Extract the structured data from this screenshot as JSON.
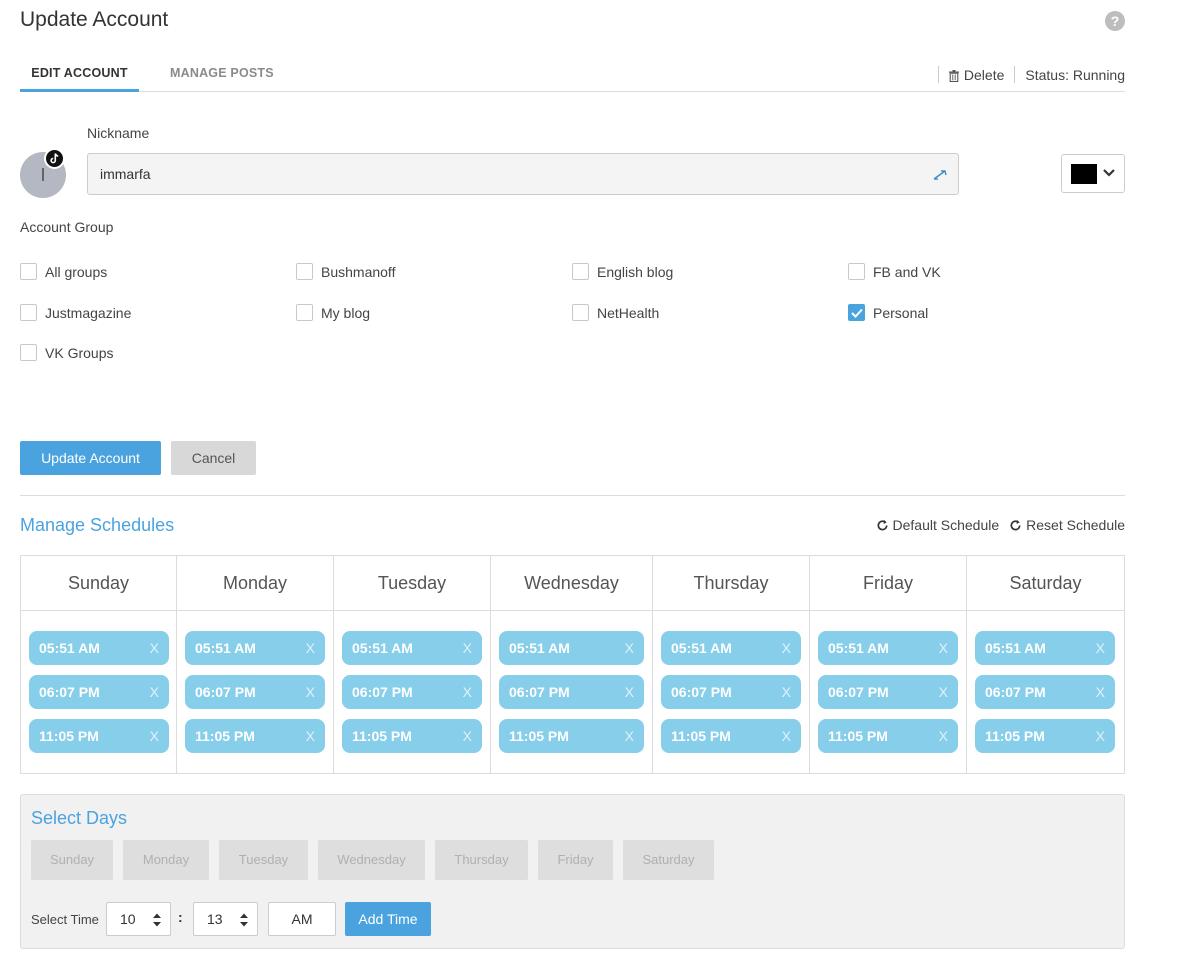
{
  "header": {
    "title": "Update Account"
  },
  "tabs": [
    {
      "label": "EDIT ACCOUNT",
      "active": true
    },
    {
      "label": "MANAGE POSTS",
      "active": false
    }
  ],
  "header_actions": {
    "delete_label": "Delete",
    "status": "Status: Running"
  },
  "account": {
    "avatar_initial": "I",
    "nickname_label": "Nickname",
    "nickname_value": "immarfa",
    "color": "#000000"
  },
  "account_group": {
    "label": "Account Group",
    "options": [
      {
        "label": "All groups",
        "checked": false
      },
      {
        "label": "Bushmanoff",
        "checked": false
      },
      {
        "label": "English blog",
        "checked": false
      },
      {
        "label": "FB and VK",
        "checked": false
      },
      {
        "label": "Justmagazine",
        "checked": false
      },
      {
        "label": "My blog",
        "checked": false
      },
      {
        "label": "NetHealth",
        "checked": false
      },
      {
        "label": "Personal",
        "checked": true
      },
      {
        "label": "VK Groups",
        "checked": false
      }
    ]
  },
  "form_buttons": {
    "update": "Update Account",
    "cancel": "Cancel"
  },
  "schedules": {
    "title": "Manage Schedules",
    "default_label": "Default Schedule",
    "reset_label": "Reset Schedule",
    "remove_label": "X",
    "days": [
      {
        "name": "Sunday",
        "times": [
          "05:51 AM",
          "06:07 PM",
          "11:05 PM"
        ]
      },
      {
        "name": "Monday",
        "times": [
          "05:51 AM",
          "06:07 PM",
          "11:05 PM"
        ]
      },
      {
        "name": "Tuesday",
        "times": [
          "05:51 AM",
          "06:07 PM",
          "11:05 PM"
        ]
      },
      {
        "name": "Wednesday",
        "times": [
          "05:51 AM",
          "06:07 PM",
          "11:05 PM"
        ]
      },
      {
        "name": "Thursday",
        "times": [
          "05:51 AM",
          "06:07 PM",
          "11:05 PM"
        ]
      },
      {
        "name": "Friday",
        "times": [
          "05:51 AM",
          "06:07 PM",
          "11:05 PM"
        ]
      },
      {
        "name": "Saturday",
        "times": [
          "05:51 AM",
          "06:07 PM",
          "11:05 PM"
        ]
      }
    ]
  },
  "select_days": {
    "title": "Select Days",
    "days": [
      "Sunday",
      "Monday",
      "Tuesday",
      "Wednesday",
      "Thursday",
      "Friday",
      "Saturday"
    ],
    "time_label": "Select Time",
    "hour": "10",
    "separator": ":",
    "minute": "13",
    "ampm": "AM",
    "add_button": "Add Time"
  },
  "colors": {
    "accent": "#4aa3df",
    "slot": "#87ceeb",
    "muted_button": "#dedede"
  }
}
